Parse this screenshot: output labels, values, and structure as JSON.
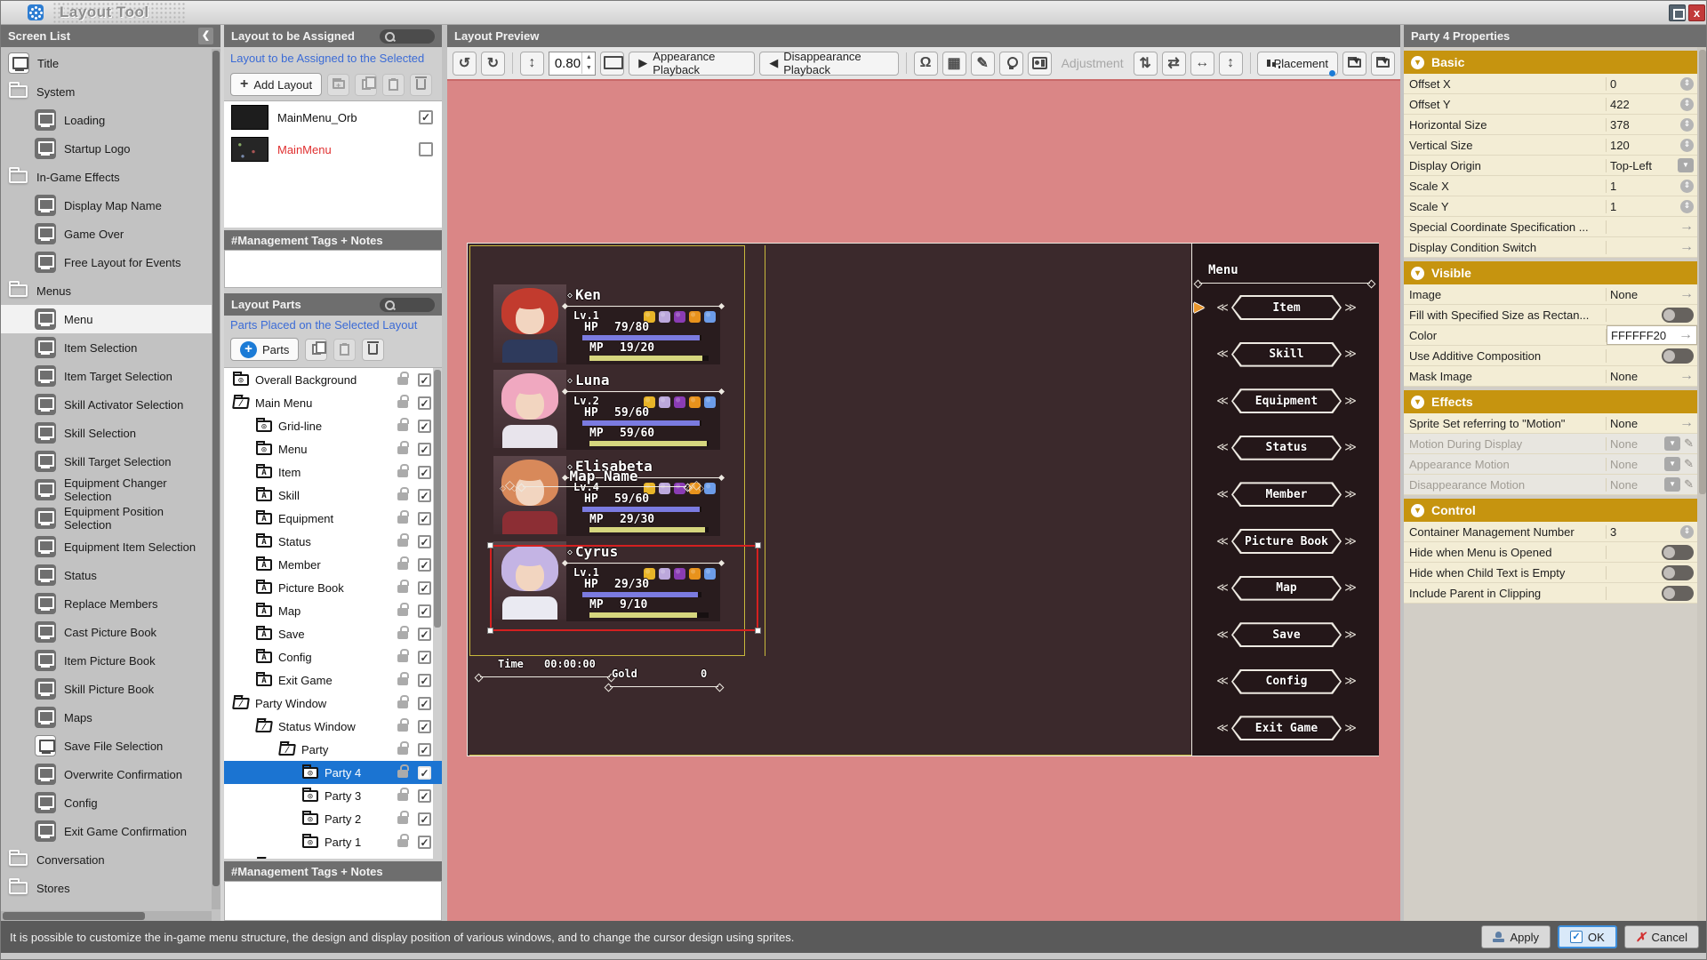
{
  "window": {
    "title": "Layout Tool"
  },
  "colors": {
    "accent_gold": "#C6940F",
    "selected_blue": "#1B74D2",
    "canvas_pink": "#DA8686",
    "screen_bg": "#3B292C",
    "hp_bar": "#7B7BE0",
    "mp_bar": "#D6D67E",
    "link_blue": "#3B6BD6",
    "error_red": "#E03030",
    "selection_red": "#D42020",
    "layout_yellow": "#C8B83C"
  },
  "icons": {
    "undo": "↺",
    "redo": "↻",
    "fit": "↕",
    "play": "▶",
    "rev": "◀",
    "magnet": "Ω",
    "grid": "▦",
    "pen": "✎",
    "updown": "⇅",
    "swap": "⇄",
    "horiz": "↔",
    "vert": "↕",
    "collapse": "❮",
    "check": "✓",
    "menu_chev_l": "≪",
    "menu_chev_r": "≫",
    "cursor": "▶"
  },
  "screen_list": {
    "title": "Screen List",
    "items": [
      {
        "label": "Title",
        "type": "screen",
        "light": true,
        "indent": 0
      },
      {
        "label": "System",
        "type": "folder",
        "indent": 0
      },
      {
        "label": "Loading",
        "type": "screen",
        "indent": 1
      },
      {
        "label": "Startup Logo",
        "type": "screen",
        "indent": 1
      },
      {
        "label": "In-Game Effects",
        "type": "folder",
        "indent": 0
      },
      {
        "label": "Display Map Name",
        "type": "screen",
        "indent": 1
      },
      {
        "label": "Game Over",
        "type": "screen",
        "indent": 1
      },
      {
        "label": "Free Layout for Events",
        "type": "screen",
        "indent": 1
      },
      {
        "label": "Menus",
        "type": "folder",
        "indent": 0
      },
      {
        "label": "Menu",
        "type": "screen",
        "indent": 1,
        "highlight": true
      },
      {
        "label": "Item Selection",
        "type": "screen",
        "indent": 1
      },
      {
        "label": "Item Target Selection",
        "type": "screen",
        "indent": 1
      },
      {
        "label": "Skill Activator Selection",
        "type": "screen",
        "indent": 1
      },
      {
        "label": "Skill Selection",
        "type": "screen",
        "indent": 1
      },
      {
        "label": "Skill Target Selection",
        "type": "screen",
        "indent": 1
      },
      {
        "label": "Equipment Changer Selection",
        "type": "screen",
        "indent": 1
      },
      {
        "label": "Equipment Position Selection",
        "type": "screen",
        "indent": 1
      },
      {
        "label": "Equipment Item Selection",
        "type": "screen",
        "indent": 1
      },
      {
        "label": "Status",
        "type": "screen",
        "indent": 1
      },
      {
        "label": "Replace Members",
        "type": "screen",
        "indent": 1
      },
      {
        "label": "Cast Picture Book",
        "type": "screen",
        "indent": 1
      },
      {
        "label": "Item Picture Book",
        "type": "screen",
        "indent": 1
      },
      {
        "label": "Skill Picture Book",
        "type": "screen",
        "indent": 1
      },
      {
        "label": "Maps",
        "type": "screen",
        "indent": 1
      },
      {
        "label": "Save File Selection",
        "type": "screen",
        "light": true,
        "indent": 1
      },
      {
        "label": "Overwrite Confirmation",
        "type": "screen",
        "indent": 1
      },
      {
        "label": "Config",
        "type": "screen",
        "indent": 1
      },
      {
        "label": "Exit Game Confirmation",
        "type": "screen",
        "indent": 1
      },
      {
        "label": "Conversation",
        "type": "folder",
        "indent": 0
      },
      {
        "label": "Stores",
        "type": "folder",
        "indent": 0
      }
    ]
  },
  "layout_assign": {
    "title": "Layout to be Assigned",
    "subtitle": "Layout to be Assigned to the Selected",
    "add_button": "Add Layout",
    "layouts": [
      {
        "name": "MainMenu_Orb",
        "checked": true,
        "red": false
      },
      {
        "name": "MainMenu",
        "checked": false,
        "red": true
      }
    ],
    "tags_header": "#Management Tags + Notes"
  },
  "layout_parts": {
    "title": "Layout Parts",
    "subtitle": "Parts Placed on the Selected Layout",
    "add_button": "Parts",
    "tags_header": "#Management Tags + Notes",
    "tree": [
      {
        "label": "Overall Background",
        "indent": 0,
        "icon": "image-folder"
      },
      {
        "label": "Main Menu",
        "indent": 0,
        "icon": "open-folder"
      },
      {
        "label": "Grid-line",
        "indent": 1,
        "icon": "image-folder"
      },
      {
        "label": "Menu",
        "indent": 1,
        "icon": "image-folder"
      },
      {
        "label": "Item",
        "indent": 1,
        "icon": "text-folder"
      },
      {
        "label": "Skill",
        "indent": 1,
        "icon": "text-folder"
      },
      {
        "label": "Equipment",
        "indent": 1,
        "icon": "text-folder"
      },
      {
        "label": "Status",
        "indent": 1,
        "icon": "text-folder"
      },
      {
        "label": "Member",
        "indent": 1,
        "icon": "text-folder"
      },
      {
        "label": "Picture Book",
        "indent": 1,
        "icon": "text-folder"
      },
      {
        "label": "Map",
        "indent": 1,
        "icon": "text-folder"
      },
      {
        "label": "Save",
        "indent": 1,
        "icon": "text-folder"
      },
      {
        "label": "Config",
        "indent": 1,
        "icon": "text-folder"
      },
      {
        "label": "Exit Game",
        "indent": 1,
        "icon": "text-folder"
      },
      {
        "label": "Party Window",
        "indent": 0,
        "icon": "open-folder"
      },
      {
        "label": "Status Window",
        "indent": 1,
        "icon": "open-folder"
      },
      {
        "label": "Party",
        "indent": 2,
        "icon": "open-folder"
      },
      {
        "label": "Party 4",
        "indent": 3,
        "icon": "image-folder",
        "selected": true
      },
      {
        "label": "Party 3",
        "indent": 3,
        "icon": "image-folder"
      },
      {
        "label": "Party 2",
        "indent": 3,
        "icon": "image-folder"
      },
      {
        "label": "Party 1",
        "indent": 3,
        "icon": "image-folder"
      }
    ]
  },
  "preview": {
    "title": "Layout Preview",
    "zoom_value": "0.80",
    "appearance_btn": "Appearance Playback",
    "disappearance_btn": "Disappearance Playback",
    "adjustment_label": "Adjustment",
    "placement_btn": "Placement",
    "game": {
      "menu_title": "Menu",
      "menu_items": [
        "Item",
        "Skill",
        "Equipment",
        "Status",
        "Member",
        "Picture Book",
        "Map",
        "Save",
        "Config",
        "Exit Game"
      ],
      "cursor_item_index": 0,
      "hp_label": "HP",
      "mp_label": "MP",
      "status_icon_colors": [
        "#E8B428",
        "#BCA8DC",
        "#8A3CB4",
        "#E8921C",
        "#6C9CE8"
      ],
      "party": [
        {
          "name": "Ken",
          "level": "Lv.1",
          "hp": "79/80",
          "mp": "19/20",
          "hair": "#C23B2E",
          "outfit": "#2E3A5C"
        },
        {
          "name": "Luna",
          "level": "Lv.2",
          "hp": "59/60",
          "mp": "59/60",
          "hair": "#F0A8C0",
          "outfit": "#E8E4EC"
        },
        {
          "name": "Elisabeta",
          "level": "Lv.4",
          "hp": "59/60",
          "mp": "29/30",
          "hair": "#D8895A",
          "outfit": "#8C2E34"
        },
        {
          "name": "Cyrus",
          "level": "Lv.1",
          "hp": "29/30",
          "mp": "9/10",
          "hair": "#C4B4E4",
          "outfit": "#EAEAF2",
          "selected": true
        }
      ],
      "time_label": "Time",
      "time_value": "00:00:00",
      "gold_label": "Gold",
      "gold_value": "0",
      "map_name": "Map Name"
    }
  },
  "properties": {
    "title": "Party 4 Properties",
    "sections": [
      {
        "label": "Basic",
        "rows": [
          {
            "label": "Offset X",
            "value": "0",
            "control": "spinner"
          },
          {
            "label": "Offset Y",
            "value": "422",
            "control": "spinner"
          },
          {
            "label": "Horizontal Size",
            "value": "378",
            "control": "spinner"
          },
          {
            "label": "Vertical Size",
            "value": "120",
            "control": "spinner"
          },
          {
            "label": "Display Origin",
            "value": "Top-Left",
            "control": "dropdown"
          },
          {
            "label": "Scale X",
            "value": "1",
            "control": "spinner"
          },
          {
            "label": "Scale Y",
            "value": "1",
            "control": "spinner"
          },
          {
            "label": "Special Coordinate Specification ...",
            "value": "",
            "control": "arrow"
          },
          {
            "label": "Display Condition Switch",
            "value": "",
            "control": "arrow"
          }
        ]
      },
      {
        "label": "Visible",
        "rows": [
          {
            "label": "Image",
            "value": "None",
            "control": "arrow"
          },
          {
            "label": "Fill with Specified Size as Rectan...",
            "value": "",
            "control": "toggle"
          },
          {
            "label": "Color",
            "value": "FFFFFF20",
            "control": "arrow",
            "input": true
          },
          {
            "label": "Use Additive Composition",
            "value": "",
            "control": "toggle"
          },
          {
            "label": "Mask Image",
            "value": "None",
            "control": "arrow"
          }
        ]
      },
      {
        "label": "Effects",
        "rows": [
          {
            "label": "Sprite Set referring to \"Motion\"",
            "value": "None",
            "control": "arrow"
          },
          {
            "label": "Motion During Display",
            "value": "None",
            "control": "motion",
            "disabled": true
          },
          {
            "label": "Appearance Motion",
            "value": "None",
            "control": "motion",
            "disabled": true
          },
          {
            "label": "Disappearance Motion",
            "value": "None",
            "control": "motion",
            "disabled": true
          }
        ]
      },
      {
        "label": "Control",
        "rows": [
          {
            "label": "Container Management Number",
            "value": "3",
            "control": "spinner"
          },
          {
            "label": "Hide when Menu is Opened",
            "value": "",
            "control": "toggle"
          },
          {
            "label": "Hide when Child Text is Empty",
            "value": "",
            "control": "toggle"
          },
          {
            "label": "Include Parent in Clipping",
            "value": "",
            "control": "toggle"
          }
        ]
      }
    ]
  },
  "statusbar": {
    "text": "It is possible to customize the in-game menu structure, the design and display position of various windows, and to change the cursor design using sprites.",
    "apply": "Apply",
    "ok": "OK",
    "cancel": "Cancel"
  }
}
